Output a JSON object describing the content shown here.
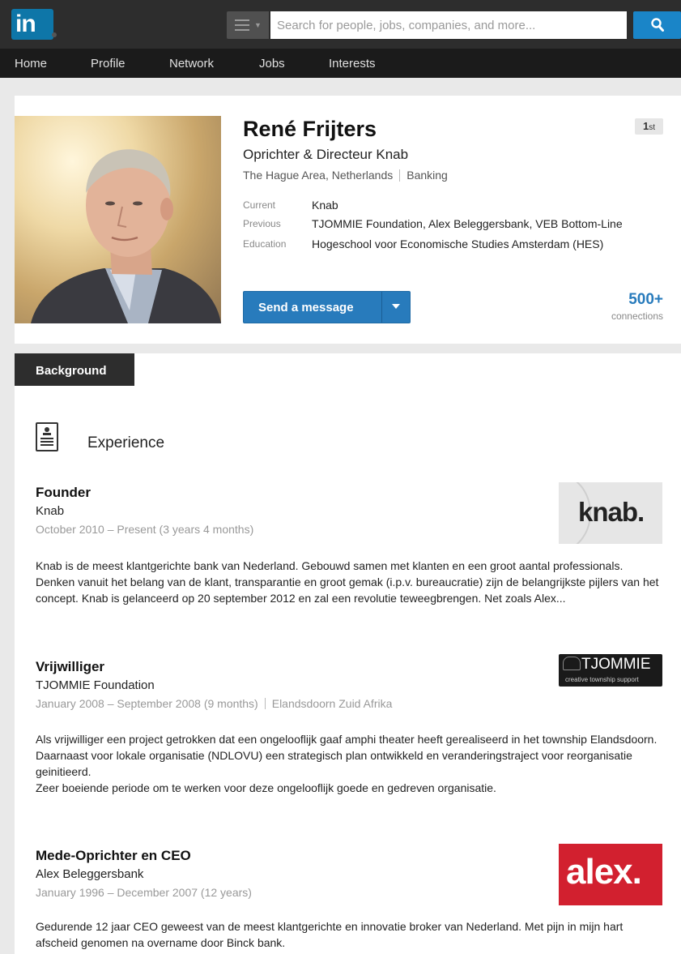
{
  "topbar": {
    "logo_text": "in",
    "search_placeholder": "Search for people, jobs, companies, and more..."
  },
  "nav": [
    "Home",
    "Profile",
    "Network",
    "Jobs",
    "Interests"
  ],
  "profile": {
    "name": "René Frijters",
    "headline": "Oprichter & Directeur Knab",
    "location": "The Hague Area, Netherlands",
    "industry": "Banking",
    "degree_num": "1",
    "degree_suffix": "st",
    "current_label": "Current",
    "current": "Knab",
    "previous_label": "Previous",
    "previous": "TJOMMIE Foundation, Alex Beleggersbank, VEB Bottom-Line",
    "education_label": "Education",
    "education": "Hogeschool voor Economische Studies Amsterdam (HES)",
    "message_button": "Send a message",
    "connections_count": "500+",
    "connections_label": "connections"
  },
  "background": {
    "tab": "Background",
    "experience_title": "Experience",
    "jobs": [
      {
        "title": "Founder",
        "company": "Knab",
        "dates": "October 2010 – Present (3 years 4 months)",
        "location": "",
        "logo_text": "knab.",
        "description": "Knab is de meest klantgerichte bank van Nederland. Gebouwd samen met klanten en een groot aantal professionals. Denken vanuit het belang van de klant, transparantie en groot gemak (i.p.v. bureaucratie) zijn de belangrijkste pijlers van het concept. Knab is gelanceerd op 20 september 2012 en zal een revolutie teweegbrengen. Net zoals Alex..."
      },
      {
        "title": "Vrijwilliger",
        "company": "TJOMMIE Foundation",
        "dates": "January 2008 – September 2008 (9 months)",
        "location": "Elandsdoorn Zuid Afrika",
        "logo_text": "TJOMMIE",
        "logo_subtext": "creative township support",
        "description_lines": [
          "Als vrijwilliger een project getrokken dat een ongelooflijk gaaf amphi theater heeft gerealiseerd in het township Elandsdoorn.",
          "Daarnaast voor lokale organisatie (NDLOVU) een strategisch plan ontwikkeld en veranderingstraject voor reorganisatie geinitieerd.",
          "Zeer boeiende periode om te werken voor deze ongelooflijk goede en gedreven organisatie."
        ]
      },
      {
        "title": "Mede-Oprichter en CEO",
        "company": "Alex Beleggersbank",
        "dates": "January 1996 – December 2007 (12 years)",
        "location": "",
        "logo_text": "alex.",
        "description": "Gedurende 12 jaar CEO geweest van de meest klantgerichte en innovatie broker van Nederland. Met pijn in mijn hart afscheid genomen na overname door Binck bank."
      }
    ]
  },
  "colors": {
    "brand_blue": "#0e76a8",
    "button_blue": "#287bbc",
    "alex_red": "#d2202f"
  }
}
